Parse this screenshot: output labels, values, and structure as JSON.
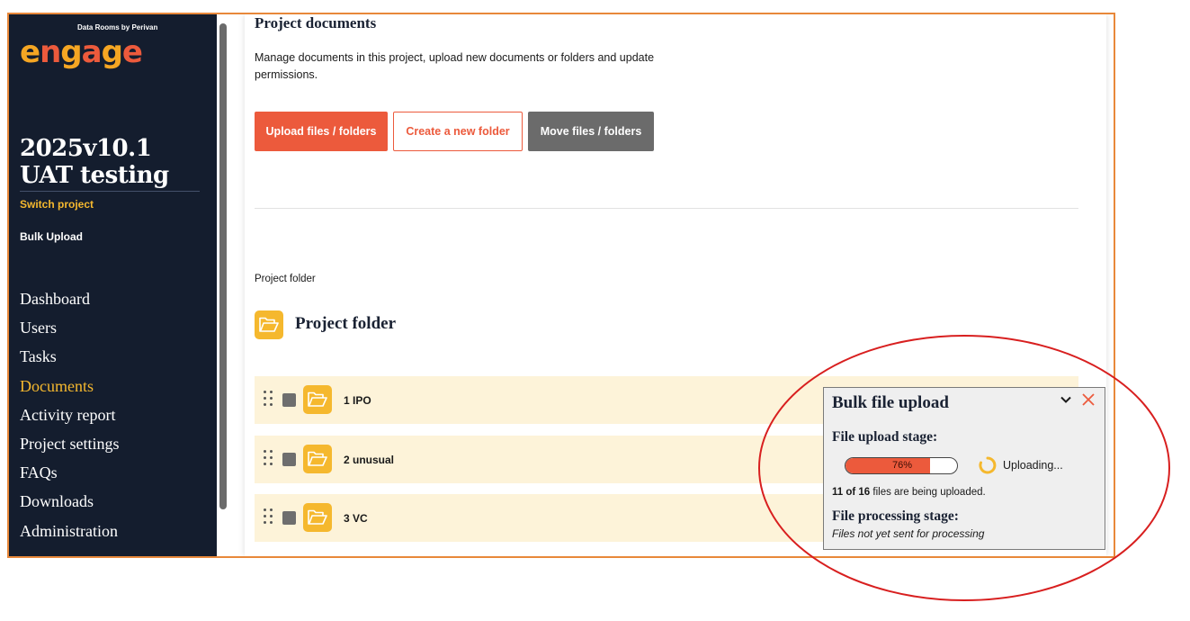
{
  "sidebar": {
    "logo_tagline": "Data Rooms by Perivan",
    "logo_letters": [
      "e",
      "n",
      "g",
      "a",
      "g",
      "e"
    ],
    "project_name": "2025v10.1 UAT testing",
    "switch_project": "Switch project",
    "bulk_upload": "Bulk Upload",
    "nav": [
      {
        "label": "Dashboard"
      },
      {
        "label": "Users"
      },
      {
        "label": "Tasks"
      },
      {
        "label": "Documents",
        "active": true
      },
      {
        "label": "Activity report"
      },
      {
        "label": "Project settings"
      },
      {
        "label": "FAQs"
      },
      {
        "label": "Downloads"
      },
      {
        "label": "Administration"
      }
    ]
  },
  "main": {
    "title": "Project documents",
    "description": "Manage documents in this project, upload new documents or folders and update permissions.",
    "buttons": {
      "upload": "Upload files / folders",
      "new_folder": "Create a new folder",
      "move": "Move files / folders"
    },
    "breadcrumb": "Project folder",
    "folder_title": "Project folder",
    "rows": [
      {
        "name": "1 IPO"
      },
      {
        "name": "2 unusual"
      },
      {
        "name": "3 VC"
      }
    ]
  },
  "bulk_panel": {
    "title": "Bulk file upload",
    "upload_stage_heading": "File upload stage:",
    "progress_percent": 76,
    "progress_label": "76%",
    "status": "Uploading...",
    "count_done": "11 of 16",
    "count_suffix": " files are being uploaded.",
    "processing_heading": "File processing stage:",
    "processing_note": "Files not yet sent for processing"
  },
  "colors": {
    "sidebar_bg": "#141d2e",
    "accent_orange": "#ec5a3c",
    "accent_yellow": "#f5b82e",
    "row_bg": "#fdf3d9",
    "highlight_ring": "#d81f1f"
  }
}
